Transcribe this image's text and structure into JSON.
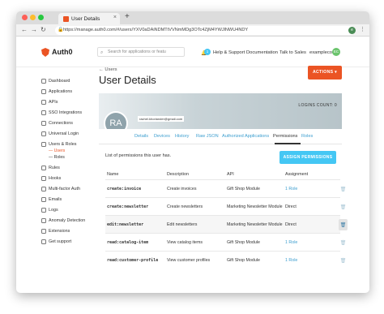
{
  "browser": {
    "tab_title": "User Details",
    "tab_close": "×",
    "new_tab": "+",
    "url": "https://manage.auth0.com/#/users/YXV0aDAiNDMTtVVNmMDg3OTc4ZjM4YWJlNWU4NDY",
    "avatar": "e"
  },
  "header": {
    "logo": "Auth0",
    "search_placeholder": "Search for applications or featu",
    "badge": "1",
    "help": "Help & Support",
    "docs": "Documentation",
    "sales": "Talk to Sales",
    "tenant": "exampleco",
    "tenant_avatar": "EC"
  },
  "sidebar": {
    "items": [
      {
        "label": "Dashboard"
      },
      {
        "label": "Applications"
      },
      {
        "label": "APIs"
      },
      {
        "label": "SSO Integrations"
      },
      {
        "label": "Connections"
      },
      {
        "label": "Universal Login"
      },
      {
        "label": "Users & Roles"
      },
      {
        "label": "Rules"
      },
      {
        "label": "Hooks"
      },
      {
        "label": "Multi-factor Auth"
      },
      {
        "label": "Emails"
      },
      {
        "label": "Logs"
      },
      {
        "label": "Anomaly Detection"
      },
      {
        "label": "Extensions"
      },
      {
        "label": "Get support"
      }
    ],
    "sub_users": "Users",
    "sub_roles": "Roles"
  },
  "main": {
    "back": "Users",
    "title": "User Details",
    "actions": "ACTIONS",
    "logins": "LOGINS COUNT: 0",
    "avatar_initials": "RA",
    "email": "rachel.khoriander@gmail.com",
    "tabs": [
      "Details",
      "Devices",
      "History",
      "Raw JSON",
      "Authorized Applications",
      "Permissions",
      "Roles"
    ],
    "list_text": "List of permissions this user has.",
    "assign": "ASSIGN PERMISSIONS"
  },
  "table": {
    "headers": [
      "Name",
      "Description",
      "API",
      "Assignment"
    ],
    "rows": [
      {
        "name": "create:invoice",
        "description": "Create invoices",
        "api": "Gift Shop Module",
        "assignment": "1 Role"
      },
      {
        "name": "create:newsletter",
        "description": "Create newsletters",
        "api": "Marketing Newsletter Module",
        "assignment": "Direct"
      },
      {
        "name": "edit:newsletter",
        "description": "Edit newsletters",
        "api": "Marketing Newsletter Module",
        "assignment": "Direct"
      },
      {
        "name": "read:catalog-item",
        "description": "View catalog items",
        "api": "Gift Shop Module",
        "assignment": "1 Role"
      },
      {
        "name": "read:customer-profile",
        "description": "View customer profiles",
        "api": "Gift Shop Module",
        "assignment": "1 Role"
      }
    ]
  },
  "colors": {
    "brand": "#eb5424",
    "link": "#3c9ecf",
    "accent": "#44c7f4"
  }
}
